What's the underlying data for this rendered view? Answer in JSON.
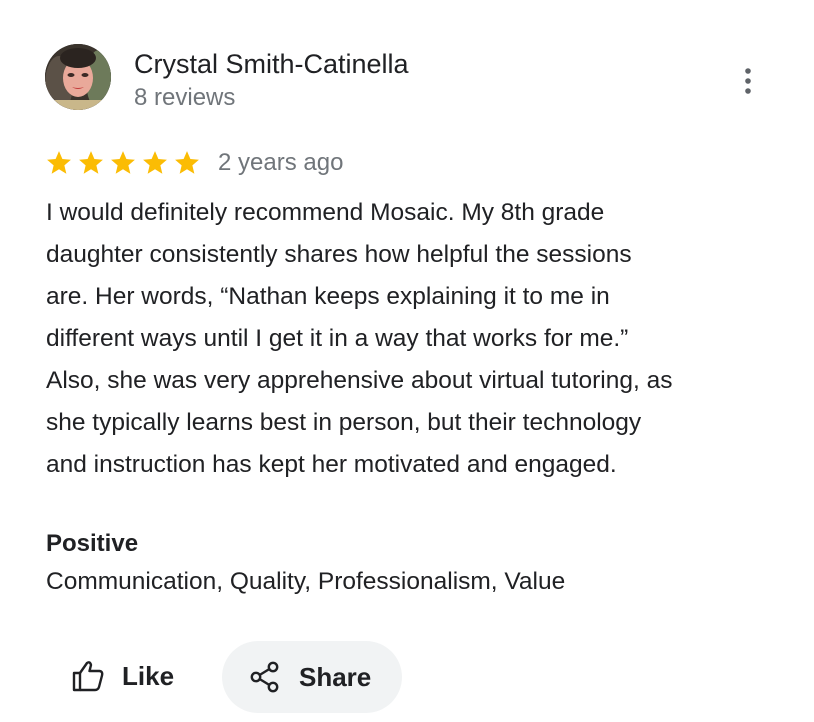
{
  "reviewer": {
    "name": "Crystal Smith-Catinella",
    "review_count": "8 reviews"
  },
  "rating": {
    "stars": 5,
    "max": 5,
    "star_color": "#fbbc04",
    "age": "2 years ago"
  },
  "review": {
    "lines": [
      "I would definitely recommend Mosaic. My 8th grade",
      "daughter consistently shares how helpful the sessions",
      "are. Her words, “Nathan keeps explaining it to me in",
      "different ways until I get it in a way that works for me.”",
      "Also, she was very apprehensive about virtual tutoring, as",
      "she typically learns best in person, but their technology",
      "and instruction has kept her motivated and engaged."
    ]
  },
  "highlights": {
    "heading": "Positive",
    "tags": "Communication, Quality, Professionalism, Value"
  },
  "actions": {
    "like_label": "Like",
    "share_label": "Share",
    "more_icon": "more-vert-icon",
    "like_icon": "thumb-up-icon",
    "share_icon": "share-icon"
  }
}
